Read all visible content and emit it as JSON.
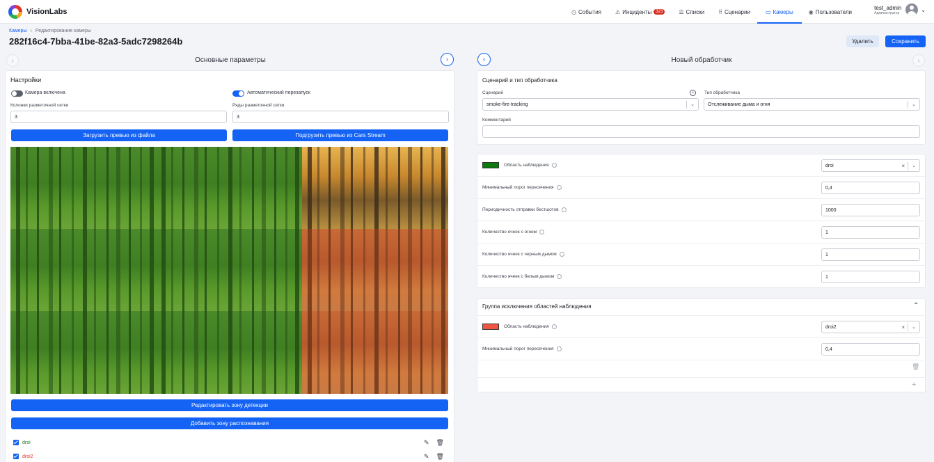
{
  "app": {
    "name": "VisionLabs"
  },
  "nav": {
    "items": [
      {
        "label": "События",
        "icon": "clock-icon",
        "glyph": "◷"
      },
      {
        "label": "Инциденты",
        "icon": "warning-icon",
        "glyph": "⚠",
        "badge": "323"
      },
      {
        "label": "Списки",
        "icon": "list-icon",
        "glyph": "☰"
      },
      {
        "label": "Сценарии",
        "icon": "grid-icon",
        "glyph": "⠿"
      },
      {
        "label": "Камеры",
        "icon": "camera-icon",
        "glyph": "▭",
        "active": true
      },
      {
        "label": "Пользователи",
        "icon": "users-icon",
        "glyph": "◉"
      }
    ]
  },
  "user": {
    "name": "test_admin",
    "role": "Администратор"
  },
  "breadcrumb": {
    "root": "Камеры",
    "sep": "›",
    "current": "Редактирование камеры"
  },
  "page": {
    "title": "282f16c4-7bba-41be-82a3-5adc7298264b"
  },
  "actions": {
    "delete": "Удалить",
    "save": "Сохранить"
  },
  "left": {
    "header": "Основные параметры",
    "settings_title": "Настройки",
    "camera_enabled": {
      "label": "Камера включена",
      "on": false
    },
    "auto_restart": {
      "label": "Автоматический перезапуск",
      "on": true
    },
    "grid_cols": {
      "label": "Колонки разметочной сетки",
      "value": "3"
    },
    "grid_rows": {
      "label": "Ряды разметочной сетки",
      "value": "3"
    },
    "upload_file": "Загрузить превью из файла",
    "upload_stream": "Подгрузить превью из Cars Stream",
    "edit_zone": "Редактировать зону детекции",
    "add_zone": "Добавить зону распознавания",
    "zones": [
      {
        "name": "droi",
        "color": "#1f7a1f"
      },
      {
        "name": "droi2",
        "color": "#e5352b"
      }
    ]
  },
  "right": {
    "header": "Новый обработчик",
    "scenario_section": "Сценарий и тип обработчика",
    "scenario": {
      "label": "Сценарий",
      "value": "smoke-fire-tracking"
    },
    "handler_type": {
      "label": "Тип обработчика",
      "value": "Отслеживание дыма и огня"
    },
    "comment": {
      "label": "Комментарий",
      "value": ""
    },
    "params": {
      "area": {
        "label": "Область наблюдения",
        "value": "droi",
        "color": "#0c7a0c"
      },
      "min_threshold": {
        "label": "Минимальный порог пересечения",
        "value": "0,4"
      },
      "period": {
        "label": "Периодичность отправки бестшотов",
        "value": "1000"
      },
      "fire_cells": {
        "label": "Количество ячеек с огнем",
        "value": "1"
      },
      "black_smoke": {
        "label": "Количество ячеек с черным дымом",
        "value": "1"
      },
      "white_smoke": {
        "label": "Количество ячеек с белым дымом",
        "value": "1"
      }
    },
    "exclusion": {
      "title": "Группа исключения областей наблюдения",
      "area": {
        "label": "Область наблюдения",
        "value": "droi2",
        "color": "#f0553f"
      },
      "min_threshold": {
        "label": "Минимальный порог пересечения",
        "value": "0,4"
      }
    }
  }
}
